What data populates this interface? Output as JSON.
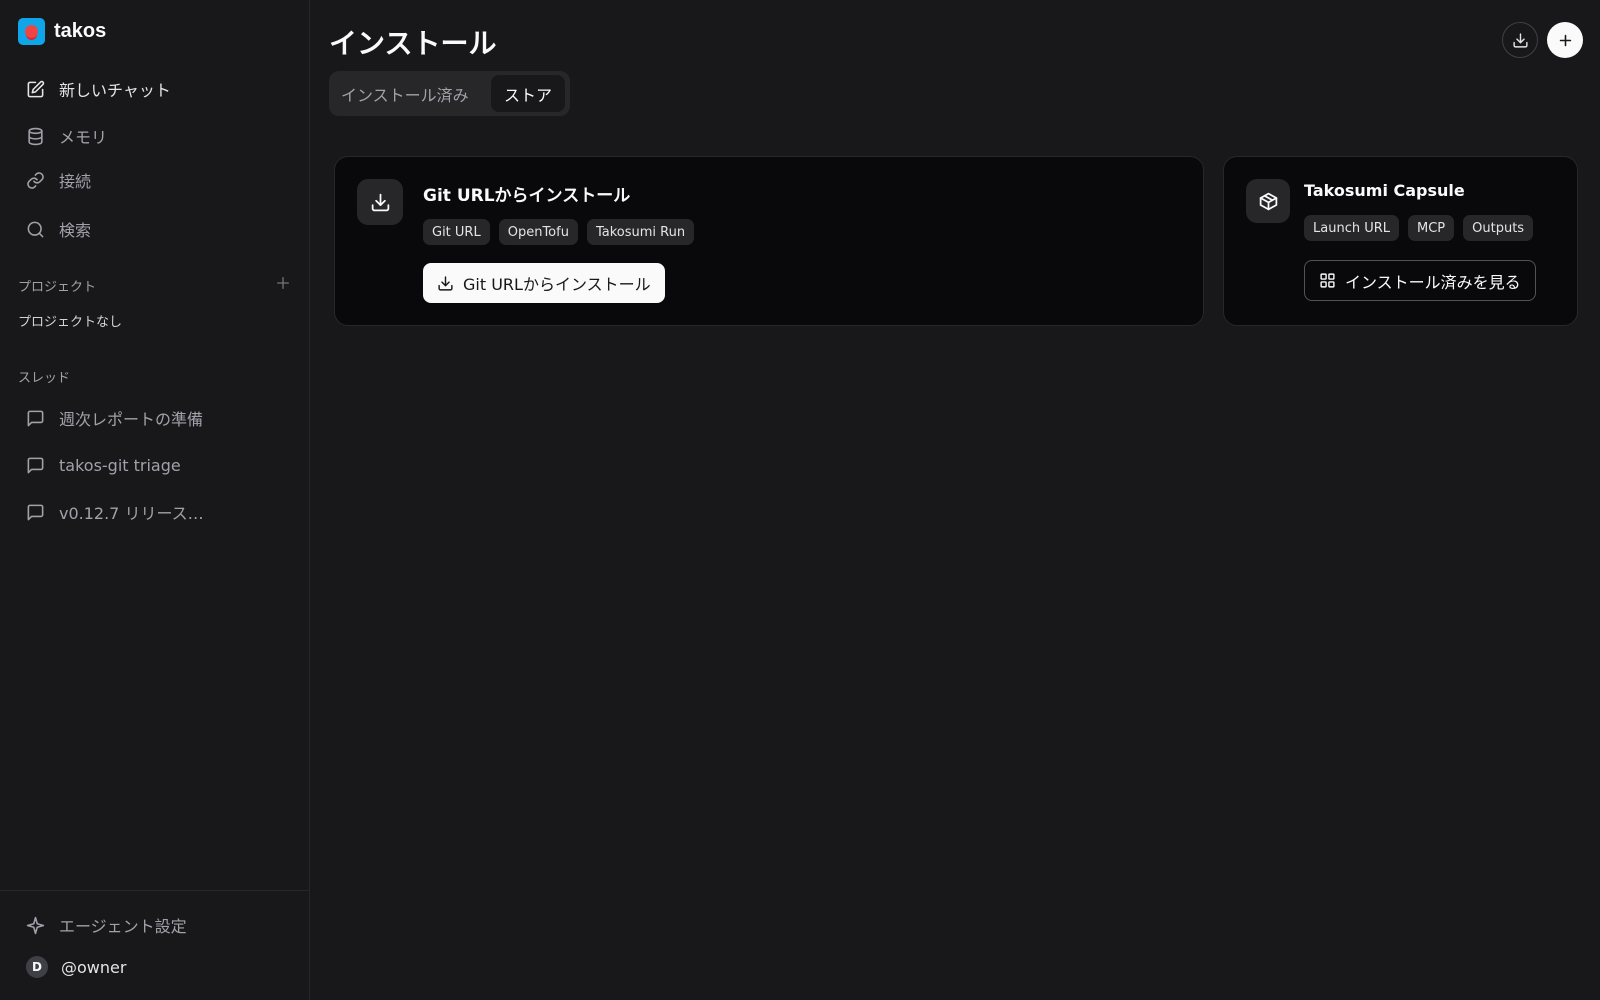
{
  "app": {
    "name": "takos",
    "colors": {
      "background": "#18181b",
      "card": "#09090b",
      "logo": "#0ea5e9",
      "accent": "#fafafa"
    }
  },
  "sidebar": {
    "nav": [
      {
        "label": "新しいチャット",
        "icon": "edit-icon"
      },
      {
        "label": "メモリ",
        "icon": "database-icon"
      },
      {
        "label": "接続",
        "icon": "link-icon"
      },
      {
        "label": "検索",
        "icon": "search-icon"
      }
    ],
    "projects": {
      "label": "プロジェクト",
      "empty": "プロジェクトなし"
    },
    "threads": {
      "label": "スレッド",
      "items": [
        {
          "label": "週次レポートの準備"
        },
        {
          "label": "takos-git triage"
        },
        {
          "label": "v0.12.7 リリース…"
        }
      ]
    },
    "footer": {
      "agent_settings": "エージェント設定",
      "avatar_initial": "D",
      "username": "@owner"
    }
  },
  "main": {
    "title": "インストール",
    "tabs": [
      {
        "label": "インストール済み",
        "active": false
      },
      {
        "label": "ストア",
        "active": true
      }
    ],
    "cards": [
      {
        "title": "Git URLからインストール",
        "icon": "download-icon",
        "tags": [
          "Git URL",
          "OpenTofu",
          "Takosumi Run"
        ],
        "button": "Git URLからインストール"
      },
      {
        "title": "Takosumi Capsule",
        "icon": "package-icon",
        "tags": [
          "Launch URL",
          "MCP",
          "Outputs"
        ],
        "button": "インストール済みを見る"
      }
    ]
  }
}
